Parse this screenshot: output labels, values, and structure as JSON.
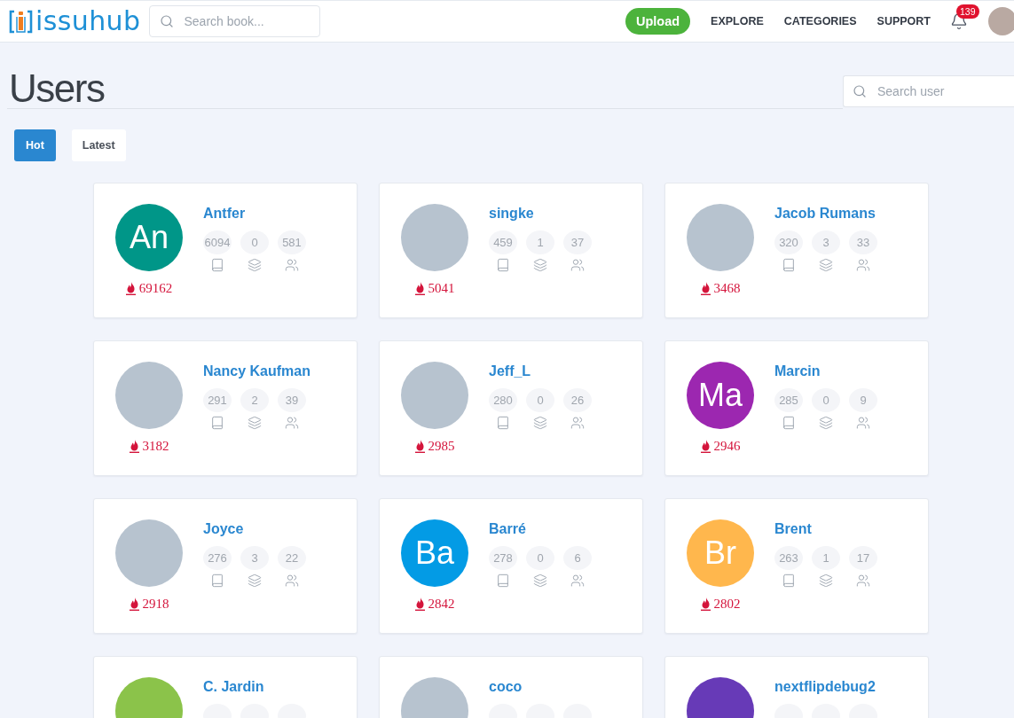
{
  "header": {
    "logo_text": "issuhub",
    "search": {
      "placeholder": "Search book..."
    },
    "upload_button": "Upload",
    "nav": [
      "EXPLORE",
      "CATEGORIES",
      "SUPPORT"
    ],
    "notifications": {
      "count": "139"
    }
  },
  "page": {
    "title": "Users",
    "search": {
      "placeholder": "Search user"
    }
  },
  "tabs": [
    {
      "label": "Hot",
      "selected": true
    },
    {
      "label": "Latest",
      "selected": false
    }
  ],
  "users": [
    {
      "name": "Antfer",
      "avatar": {
        "kind": "initials",
        "initials": "An",
        "color": "#009688"
      },
      "stats": [
        "6094",
        "0",
        "581"
      ],
      "score": "69162"
    },
    {
      "name": "singke",
      "avatar": {
        "kind": "photo"
      },
      "stats": [
        "459",
        "1",
        "37"
      ],
      "score": "5041"
    },
    {
      "name": "Jacob Rumans",
      "avatar": {
        "kind": "photo"
      },
      "stats": [
        "320",
        "3",
        "33"
      ],
      "score": "3468"
    },
    {
      "name": "Nancy Kaufman",
      "avatar": {
        "kind": "photo"
      },
      "stats": [
        "291",
        "2",
        "39"
      ],
      "score": "3182"
    },
    {
      "name": "Jeff_L",
      "avatar": {
        "kind": "photo"
      },
      "stats": [
        "280",
        "0",
        "26"
      ],
      "score": "2985"
    },
    {
      "name": "Marcin",
      "avatar": {
        "kind": "initials",
        "initials": "Ma",
        "color": "#9c27b0"
      },
      "stats": [
        "285",
        "0",
        "9"
      ],
      "score": "2946"
    },
    {
      "name": "Joyce",
      "avatar": {
        "kind": "photo"
      },
      "stats": [
        "276",
        "3",
        "22"
      ],
      "score": "2918"
    },
    {
      "name": "Barré",
      "avatar": {
        "kind": "initials",
        "initials": "Ba",
        "color": "#039be5"
      },
      "stats": [
        "278",
        "0",
        "6"
      ],
      "score": "2842"
    },
    {
      "name": "Brent",
      "avatar": {
        "kind": "initials",
        "initials": "Br",
        "color": "#ffb74d"
      },
      "stats": [
        "263",
        "1",
        "17"
      ],
      "score": "2802"
    },
    {
      "name": "C. Jardin",
      "avatar": {
        "kind": "initials",
        "color": "#8bc34a"
      }
    },
    {
      "name": "coco",
      "avatar": {
        "kind": "photo"
      }
    },
    {
      "name": "nextflipdebug2",
      "avatar": {
        "kind": "initials",
        "color": "#673ab7"
      }
    }
  ]
}
